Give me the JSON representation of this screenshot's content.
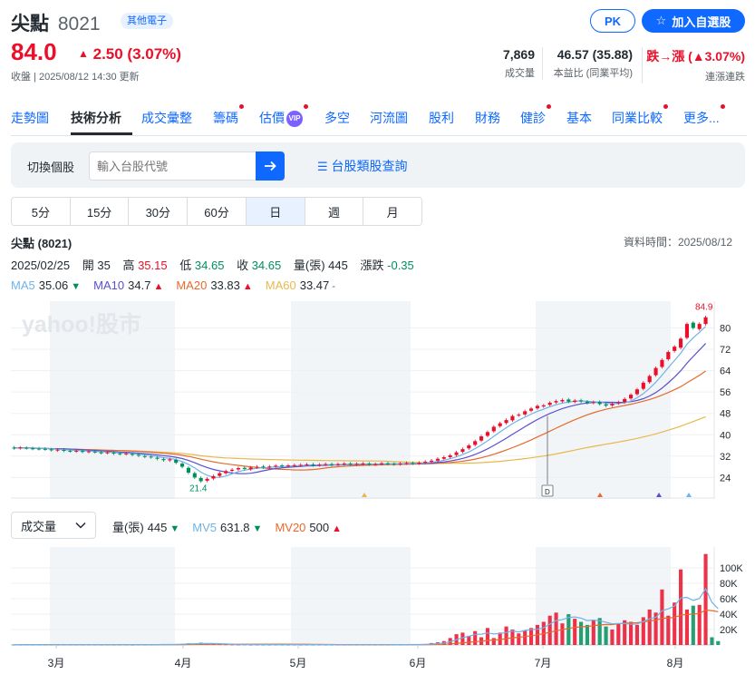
{
  "header": {
    "name": "尖點",
    "code": "8021",
    "tag": "其他電子",
    "price": "84.0",
    "change": "2.50 (3.07%)",
    "status": "收盤 | 2025/08/12 14:30 更新",
    "pk_label": "PK",
    "add_label": "加入自選股",
    "stats": [
      {
        "value": "7,869",
        "label": "成交量"
      },
      {
        "value": "46.57 (35.88)",
        "label": "本益比 (同業平均)"
      },
      {
        "value": "跌→漲 (▲3.07%)",
        "label": "連漲連跌"
      }
    ]
  },
  "tabs": [
    {
      "label": "走勢圖",
      "dot": false
    },
    {
      "label": "技術分析",
      "dot": false
    },
    {
      "label": "成交彙整",
      "dot": false
    },
    {
      "label": "籌碼",
      "dot": true
    },
    {
      "label": "估價",
      "dot": true
    },
    {
      "label": "多空",
      "dot": false
    },
    {
      "label": "河流圖",
      "dot": false
    },
    {
      "label": "股利",
      "dot": false
    },
    {
      "label": "財務",
      "dot": false
    },
    {
      "label": "健診",
      "dot": true
    },
    {
      "label": "基本",
      "dot": false
    },
    {
      "label": "同業比較",
      "dot": true
    },
    {
      "label": "更多...",
      "dot": true
    }
  ],
  "vip_label": "VIP",
  "search": {
    "label": "切換個股",
    "placeholder": "輸入台股代號",
    "category_link": "台股類股查詢"
  },
  "periods": [
    "5分",
    "15分",
    "30分",
    "60分",
    "日",
    "週",
    "月"
  ],
  "chart_header": {
    "title": "尖點 (8021)",
    "data_time": "資料時間：2025/08/12",
    "ohlc": {
      "date": "2025/02/25",
      "open_label": "開",
      "open": "35",
      "high_label": "高",
      "high": "35.15",
      "low_label": "低",
      "low": "34.65",
      "close_label": "收",
      "close": "34.65",
      "vol_label": "量(張)",
      "vol": "445",
      "chg_label": "漲跌",
      "chg": "-0.35"
    },
    "ma": [
      {
        "label": "MA5",
        "value": "35.06",
        "arrow": "▼",
        "color": "#6fb3e8",
        "arrow_color": "#008f5a"
      },
      {
        "label": "MA10",
        "value": "34.7",
        "arrow": "▲",
        "color": "#5a4fcf",
        "arrow_color": "#eb0f29"
      },
      {
        "label": "MA20",
        "value": "33.83",
        "arrow": "▲",
        "color": "#e66a2c",
        "arrow_color": "#eb0f29"
      },
      {
        "label": "MA60",
        "value": "33.47",
        "arrow": "-",
        "color": "#e8b84a",
        "arrow_color": "#5b636a"
      }
    ]
  },
  "volume_header": {
    "select": "成交量",
    "items": [
      {
        "label": "量(張)",
        "value": "445",
        "arrow": "▼",
        "color": "#232a31",
        "arrow_color": "#008f5a"
      },
      {
        "label": "MV5",
        "value": "631.8",
        "arrow": "▼",
        "color": "#6fb3e8",
        "arrow_color": "#008f5a"
      },
      {
        "label": "MV20",
        "value": "500",
        "arrow": "▲",
        "color": "#e66a2c",
        "arrow_color": "#eb0f29"
      }
    ]
  },
  "watermark": "yahoo!股市",
  "chart_data": {
    "type": "candlestick",
    "price_axis": {
      "ticks": [
        24,
        32,
        40,
        48,
        56,
        64,
        72,
        80
      ],
      "range": [
        18,
        88
      ]
    },
    "volume_axis": {
      "ticks": [
        "20K",
        "40K",
        "60K",
        "80K",
        "100K"
      ],
      "range": [
        0,
        120000
      ]
    },
    "x_labels": [
      "3月",
      "4月",
      "5月",
      "6月",
      "7月",
      "8月"
    ],
    "annotations": {
      "high": "84.9",
      "low": "21.4",
      "marker": "D"
    },
    "ohlc_close": [
      35,
      35.2,
      35,
      34.8,
      34.7,
      34.6,
      34.3,
      34.4,
      34.1,
      33.9,
      34,
      33.7,
      33.8,
      33.5,
      33.2,
      33.4,
      33,
      32.8,
      33,
      32.5,
      32.2,
      31.8,
      31.6,
      31,
      30.5,
      30.8,
      29.5,
      28,
      25.8,
      24,
      22.6,
      23.5,
      24.5,
      25.6,
      26.4,
      26.9,
      27.5,
      27.2,
      27.7,
      28,
      27.8,
      28.1,
      28.4,
      28.2,
      28.5,
      28.6,
      28.7,
      28.9,
      28.6,
      28.8,
      29,
      28.7,
      29,
      29.2,
      28.9,
      29.1,
      29.2,
      28.9,
      29,
      29.3,
      29.1,
      29,
      29.2,
      29.4,
      29.3,
      29.5,
      29.9,
      30.3,
      31,
      31.6,
      32.3,
      33.4,
      34.6,
      36,
      37.6,
      39.4,
      41,
      43,
      44.3,
      45.5,
      47,
      47.5,
      48.8,
      49.8,
      50.8,
      51,
      52,
      52.6,
      53,
      52.4,
      52.8,
      52.5,
      51.9,
      52.2,
      51.5,
      50.9,
      51.6,
      52.2,
      53.4,
      55,
      57,
      59.5,
      62,
      65,
      68,
      71,
      73,
      76,
      81.5,
      80,
      81.5,
      84
    ],
    "ohlc_open": [
      35.2,
      35,
      35.1,
      34.9,
      34.8,
      34.7,
      34.5,
      34.2,
      34.3,
      34,
      33.8,
      33.9,
      33.6,
      33.7,
      33.4,
      33.2,
      33.3,
      33,
      32.8,
      32.8,
      32.5,
      32,
      31.8,
      31.4,
      30.9,
      30.4,
      30.6,
      29.2,
      27.6,
      25.6,
      23.8,
      22.8,
      23.6,
      24.6,
      25.6,
      26.5,
      27,
      27.6,
      27.1,
      27.8,
      28.1,
      27.8,
      28.2,
      28.5,
      28.3,
      28.5,
      28.6,
      28.8,
      28.9,
      28.6,
      28.9,
      29,
      28.8,
      29,
      29.2,
      28.9,
      29.1,
      29.2,
      28.9,
      29.1,
      29.3,
      29.1,
      29,
      29.3,
      29.4,
      29.3,
      29.5,
      29.9,
      30.3,
      31,
      31.6,
      32.4,
      33.6,
      34.9,
      36.2,
      37.8,
      39.6,
      41.3,
      43.2,
      44.4,
      45.4,
      47.3,
      47.6,
      49,
      49.9,
      50.6,
      51.2,
      52.1,
      52.5,
      53.2,
      52.3,
      52.9,
      52.4,
      52,
      52.3,
      51.4,
      51,
      51.8,
      52.3,
      53.6,
      55.2,
      57.2,
      59.7,
      62.3,
      65.4,
      68.3,
      71.4,
      72.6,
      76.3,
      82,
      79.6,
      81.5
    ],
    "volume": [
      500,
      400,
      450,
      380,
      420,
      390,
      410,
      360,
      350,
      400,
      380,
      340,
      370,
      350,
      330,
      360,
      320,
      310,
      350,
      300,
      380,
      420,
      500,
      600,
      800,
      900,
      1100,
      1500,
      2200,
      1800,
      3000,
      1400,
      1200,
      900,
      800,
      700,
      600,
      650,
      500,
      550,
      500,
      480,
      520,
      450,
      430,
      470,
      420,
      440,
      410,
      430,
      400,
      390,
      420,
      380,
      410,
      400,
      380,
      420,
      390,
      410,
      450,
      480,
      520,
      600,
      700,
      900,
      1200,
      2500,
      3500,
      5000,
      9000,
      14000,
      16000,
      12000,
      18000,
      10000,
      22000,
      9000,
      16000,
      24000,
      20000,
      15000,
      19000,
      22000,
      26000,
      30000,
      38000,
      42000,
      28000,
      40000,
      34000,
      30000,
      26000,
      32000,
      35000,
      24000,
      20000,
      28000,
      32000,
      30000,
      26000,
      36000,
      46000,
      42000,
      72000,
      38000,
      55000,
      98000,
      46000,
      51000,
      52000,
      118000,
      10000,
      5000
    ]
  }
}
